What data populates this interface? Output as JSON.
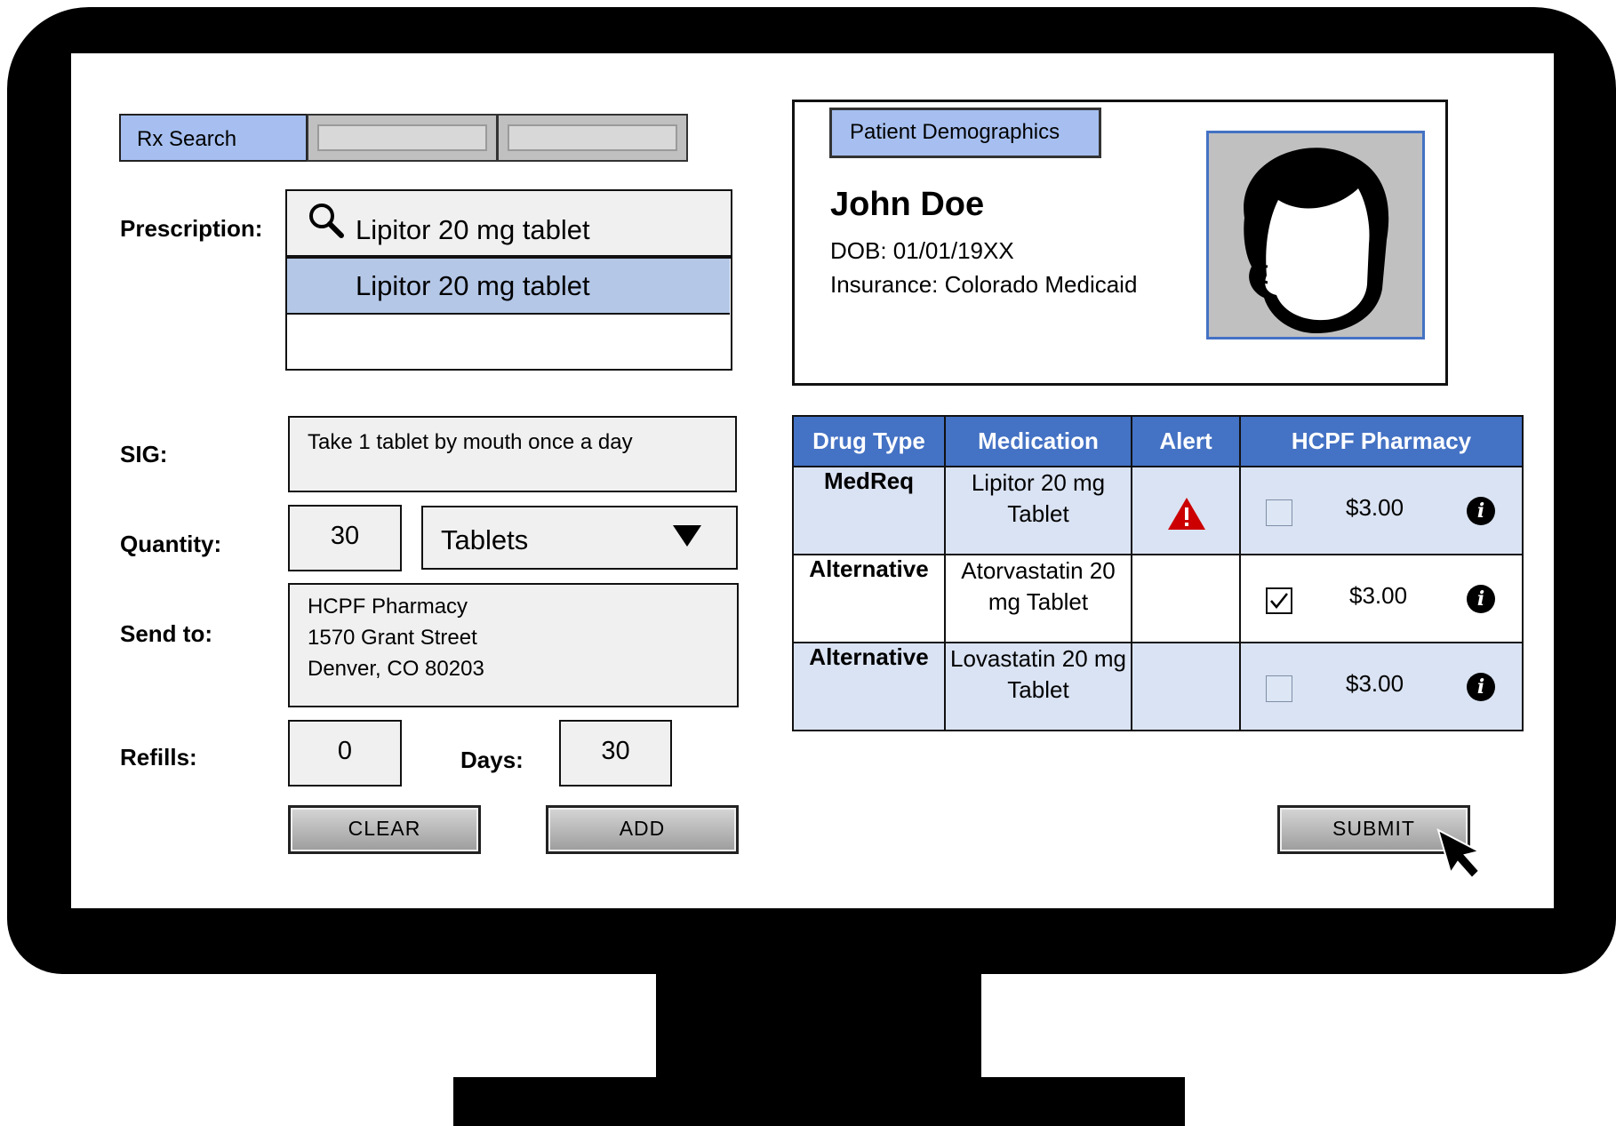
{
  "tabs": [
    {
      "label": "Rx Search",
      "active": true
    },
    {
      "label": "",
      "active": false
    },
    {
      "label": "",
      "active": false
    }
  ],
  "form": {
    "prescription_label": "Prescription:",
    "prescription_value": "Lipitor 20 mg tablet",
    "suggestions": [
      "Lipitor 20 mg tablet",
      ""
    ],
    "sig_label": "SIG:",
    "sig_value": "Take 1 tablet by mouth once a day",
    "quantity_label": "Quantity:",
    "quantity_value": "30",
    "unit_selected": "Tablets",
    "send_to_label": "Send to:",
    "send_to_lines": [
      "HCPF Pharmacy",
      "1570 Grant Street",
      "Denver, CO 80203"
    ],
    "refills_label": "Refills:",
    "refills_value": "0",
    "days_label": "Days:",
    "days_value": "30",
    "clear_label": "CLEAR",
    "add_label": "ADD"
  },
  "patient": {
    "tab_label": "Patient Demographics",
    "name": "John Doe",
    "dob": "DOB: 01/01/19XX",
    "insurance": "Insurance: Colorado Medicaid"
  },
  "table": {
    "headers": [
      "Drug Type",
      "Medication",
      "Alert",
      "HCPF Pharmacy"
    ],
    "rows": [
      {
        "drug_type": "MedReq",
        "medication": "Lipitor 20 mg Tablet",
        "alert": "warning-icon",
        "checked": false,
        "price": "$3.00"
      },
      {
        "drug_type": "Alternative",
        "medication": "Atorvastatin 20 mg Tablet",
        "alert": "",
        "checked": true,
        "price": "$3.00"
      },
      {
        "drug_type": "Alternative",
        "medication": "Lovastatin 20 mg Tablet",
        "alert": "",
        "checked": false,
        "price": "$3.00"
      }
    ]
  },
  "submit_label": "SUBMIT",
  "colors": {
    "accent": "#4472c4",
    "tab_active": "#a6bff0",
    "row_highlight": "#dae3f3",
    "suggestion_highlight": "#b4c7e7",
    "alert": "#cc0000"
  }
}
